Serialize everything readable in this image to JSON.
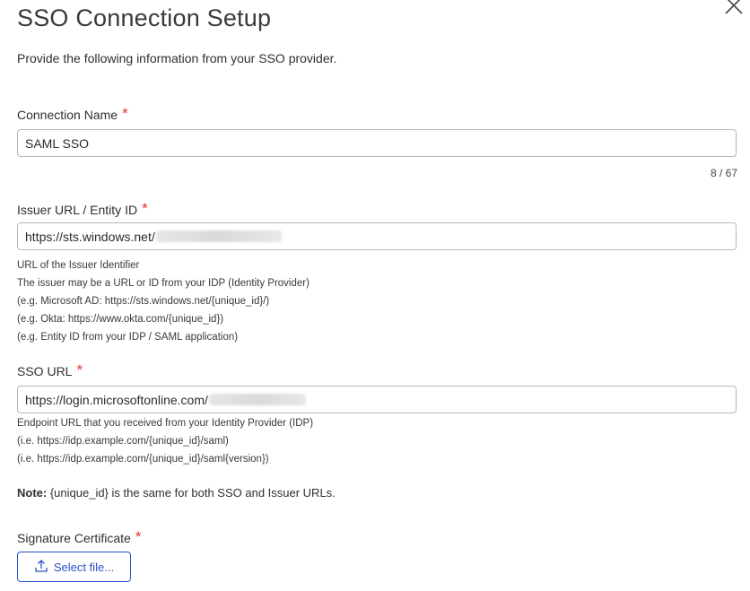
{
  "dialog": {
    "title": "SSO Connection Setup",
    "subtitle": "Provide the following information from your SSO provider.",
    "required_mark": "*"
  },
  "connection_name": {
    "label": "Connection Name",
    "value": "SAML SSO",
    "counter": "8 / 67"
  },
  "issuer": {
    "label": "Issuer URL / Entity ID",
    "value": "https://sts.windows.net/",
    "help": [
      "URL of the Issuer Identifier",
      "The issuer may be a URL or ID from your IDP (Identity Provider)",
      "(e.g. Microsoft AD: https://sts.windows.net/{unique_id}/)",
      "(e.g. Okta: https://www.okta.com/{unique_id})",
      "(e.g. Entity ID from your IDP / SAML application)"
    ]
  },
  "sso_url": {
    "label": "SSO URL",
    "value": "https://login.microsoftonline.com/",
    "help": [
      "Endpoint URL that you received from your Identity Provider (IDP)",
      "(i.e. https://idp.example.com/{unique_id}/saml)",
      "(i.e. https://idp.example.com/{unique_id}/saml{version})"
    ]
  },
  "note": {
    "prefix": "Note:",
    "text": " {unique_id} is the same for both SSO and Issuer URLs."
  },
  "certificate": {
    "label": "Signature Certificate",
    "button_label": "Select file..."
  },
  "colors": {
    "accent": "#2c4fc8",
    "required": "#e0362b",
    "border": "#b5b8bd"
  }
}
